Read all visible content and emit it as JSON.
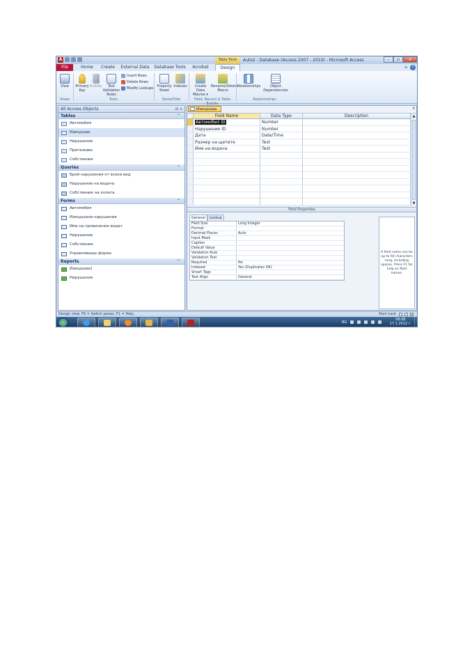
{
  "window": {
    "title": "Auto2 : Database (Access 2007 - 2010) - Microsoft Access",
    "context_tab_group": "Table Tools",
    "min": "–",
    "max": "▫",
    "close": "x"
  },
  "ribbon_tabs": [
    "File",
    "Home",
    "Create",
    "External Data",
    "Database Tools",
    "Acrobat",
    "Design"
  ],
  "ribbon": {
    "view": "View",
    "primary_key": "Primary Key",
    "builder": "Builder",
    "test_validation_rules": "Test Validation Rules",
    "insert_rows": "Insert Rows",
    "delete_rows": "Delete Rows",
    "modify_lookups": "Modify Lookups",
    "property_sheet": "Property Sheet",
    "indexes": "Indexes",
    "create_data_macros": "Create Data Macros ▾",
    "rename_delete_macro": "Rename/Delete Macro",
    "relationships": "Relationships",
    "object_dependencies": "Object Dependencies",
    "groups": [
      "Views",
      "Tools",
      "Show/Hide",
      "Field, Record & Table Events",
      "Relationships"
    ]
  },
  "nav": {
    "header": "All Access Objects",
    "header_controls": "⊙ «",
    "groups": [
      {
        "name": "Tables",
        "items": [
          "Автомобил",
          "Извършва",
          "Нарушение",
          "Притежава",
          "Собственик"
        ]
      },
      {
        "name": "Queries",
        "items": [
          "Брой нарушения от всеки вид",
          "Нарушение на водача",
          "Собственик на колата"
        ]
      },
      {
        "name": "Forms",
        "items": [
          "Автомобил",
          "Извършени нарушения",
          "Име на провинения водач",
          "Нарушение",
          "Собственик",
          "Управляваща форма"
        ]
      },
      {
        "name": "Reports",
        "items": [
          "Извършва1",
          "Нарушения"
        ]
      }
    ],
    "chevron": "⌃"
  },
  "document": {
    "tab_label": "Извършва",
    "close": "x",
    "columns": [
      "Field Name",
      "Data Type",
      "Description"
    ],
    "rows": [
      {
        "field": "Автомобил ID",
        "type": "Number",
        "description": ""
      },
      {
        "field": "Нарушение ID",
        "type": "Number",
        "description": ""
      },
      {
        "field": "Дата",
        "type": "Date/Time",
        "description": ""
      },
      {
        "field": "Размер на щетите",
        "type": "Text",
        "description": ""
      },
      {
        "field": "Име на водача",
        "type": "Text",
        "description": ""
      }
    ],
    "empty_rows": 8,
    "field_properties_title": "Field Properties",
    "property_tabs": [
      "General",
      "Lookup"
    ],
    "properties": [
      {
        "key": "Field Size",
        "value": "Long Integer"
      },
      {
        "key": "Format",
        "value": ""
      },
      {
        "key": "Decimal Places",
        "value": "Auto"
      },
      {
        "key": "Input Mask",
        "value": ""
      },
      {
        "key": "Caption",
        "value": ""
      },
      {
        "key": "Default Value",
        "value": ""
      },
      {
        "key": "Validation Rule",
        "value": ""
      },
      {
        "key": "Validation Text",
        "value": ""
      },
      {
        "key": "Required",
        "value": "No"
      },
      {
        "key": "Indexed",
        "value": "Yes (Duplicates OK)"
      },
      {
        "key": "Smart Tags",
        "value": ""
      },
      {
        "key": "Text Align",
        "value": "General"
      }
    ],
    "help_text": "A field name can be up to 64 characters long, including spaces. Press F1 for help on field names."
  },
  "statusbar": {
    "left": "Design view.  F6 = Switch panes.  F1 = Help.",
    "right": "Num Lock"
  },
  "taskbar": {
    "lang": "BG",
    "time": "08:06",
    "date": "17.1.2012 г."
  },
  "colors": {
    "file_tab": "#b8153a",
    "context_tools": "#e2c45e",
    "taskbar": "#17375c"
  }
}
